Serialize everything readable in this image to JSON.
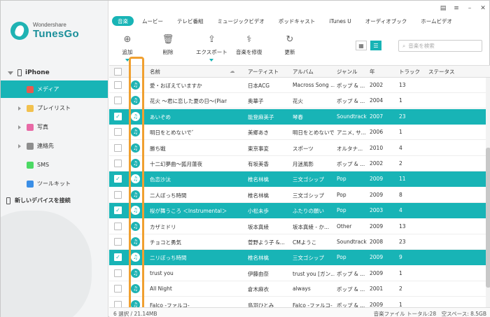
{
  "app": {
    "brand": "Wondershare",
    "product": "TunesGo"
  },
  "sidebar": {
    "device_name": "iPhone",
    "items": [
      {
        "label": "メディア",
        "icon": "music-icon",
        "color": "#e85a4f",
        "active": true
      },
      {
        "label": "プレイリスト",
        "icon": "playlist-icon",
        "color": "#f2c14e",
        "active": false
      },
      {
        "label": "写真",
        "icon": "photos-icon",
        "color": "#e86aa6",
        "active": false
      },
      {
        "label": "連絡先",
        "icon": "contacts-icon",
        "color": "#8e8e8e",
        "active": false
      },
      {
        "label": "SMS",
        "icon": "sms-icon",
        "color": "#4cd964",
        "active": false
      },
      {
        "label": "ツールキット",
        "icon": "toolkit-icon",
        "color": "#3a8ee6",
        "active": false
      }
    ],
    "connect_label": "新しいデバイスを接続"
  },
  "tabs": [
    "音楽",
    "ムービー",
    "テレビ番組",
    "ミュージックビデオ",
    "ポッドキャスト",
    "iTunes U",
    "オーディオブック",
    "ホームビデオ"
  ],
  "toolbar": {
    "add": "追加",
    "delete": "削除",
    "export": "エクスポート",
    "repair": "音楽を修復",
    "refresh": "更新"
  },
  "search": {
    "placeholder": "音楽を検索"
  },
  "columns": {
    "name": "名前",
    "artist": "アーティスト",
    "album": "アルバム",
    "genre": "ジャンル",
    "year": "年",
    "track": "トラック",
    "status": "ステータス"
  },
  "rows": [
    {
      "name": "愛・おぼえていますか",
      "artist": "日本ACG",
      "album": "Macross Song ...",
      "genre": "ポップ & ...",
      "year": "2002",
      "track": "13",
      "selected": false
    },
    {
      "name": "花火 ～君に恋した夏の日～(Pian...",
      "artist": "奥華子",
      "album": "花火",
      "genre": "ポップ & ...",
      "year": "2004",
      "track": "1",
      "selected": false
    },
    {
      "name": "あいぞめ",
      "artist": "能登麻美子",
      "album": "琴春",
      "genre": "Soundtrack",
      "year": "2007",
      "track": "23",
      "selected": true
    },
    {
      "name": "明日をとめないで゛",
      "artist": "美郷あき",
      "album": "明日をとめないで",
      "genre": "アニメ, サ...",
      "year": "2006",
      "track": "1",
      "selected": false
    },
    {
      "name": "勝ち戦",
      "artist": "東京事変",
      "album": "スポーツ",
      "genre": "オルタナ...",
      "year": "2010",
      "track": "4",
      "selected": false
    },
    {
      "name": "十二幻夢曲～狐月蓮夜",
      "artist": "有坂美香",
      "album": "月迷風影",
      "genre": "ポップ & ...",
      "year": "2002",
      "track": "2",
      "selected": false
    },
    {
      "name": "色恋沙汰",
      "artist": "椎名林檎",
      "album": "三文ゴシップ",
      "genre": "Pop",
      "year": "2009",
      "track": "11",
      "selected": true
    },
    {
      "name": "二人ぼっち時間",
      "artist": "椎名林檎",
      "album": "三文ゴシップ",
      "genre": "Pop",
      "year": "2009",
      "track": "8",
      "selected": false
    },
    {
      "name": "桜が舞うころ ＜Instrumental＞",
      "artist": "小松未歩",
      "album": "ふたりの願い",
      "genre": "Pop",
      "year": "2003",
      "track": "4",
      "selected": true
    },
    {
      "name": "カザミドリ",
      "artist": "坂本真綾",
      "album": "坂本真綾 - か...",
      "genre": "Other",
      "year": "2009",
      "track": "13",
      "selected": false
    },
    {
      "name": "チョコと勇気",
      "artist": "菅野よう子 &...",
      "album": "CMようこ",
      "genre": "Soundtrack",
      "year": "2008",
      "track": "23",
      "selected": false
    },
    {
      "name": "二リぼっち時間",
      "artist": "椎名林檎",
      "album": "三文ゴシップ",
      "genre": "Pop",
      "year": "2009",
      "track": "9",
      "selected": true
    },
    {
      "name": "trust you",
      "artist": "伊藤由奈",
      "album": "trust you [ガン...",
      "genre": "ポップ & ...",
      "year": "2009",
      "track": "1",
      "selected": false
    },
    {
      "name": "All Night",
      "artist": "倉木麻衣",
      "album": "always",
      "genre": "ポップ & ...",
      "year": "2001",
      "track": "2",
      "selected": false
    },
    {
      "name": "Falco -ファルコ-",
      "artist": "鳥羽ひとみ",
      "album": "Falco -ファルコ-",
      "genre": "ポップ & ...",
      "year": "2009",
      "track": "1",
      "selected": false
    }
  ],
  "status": {
    "left": "6 選択 / 21.14MB",
    "right": "音楽ファイル トータル:28　空スペース: 8.5GB"
  },
  "colors": {
    "accent": "#18b4b6",
    "highlight": "#f0a030"
  }
}
